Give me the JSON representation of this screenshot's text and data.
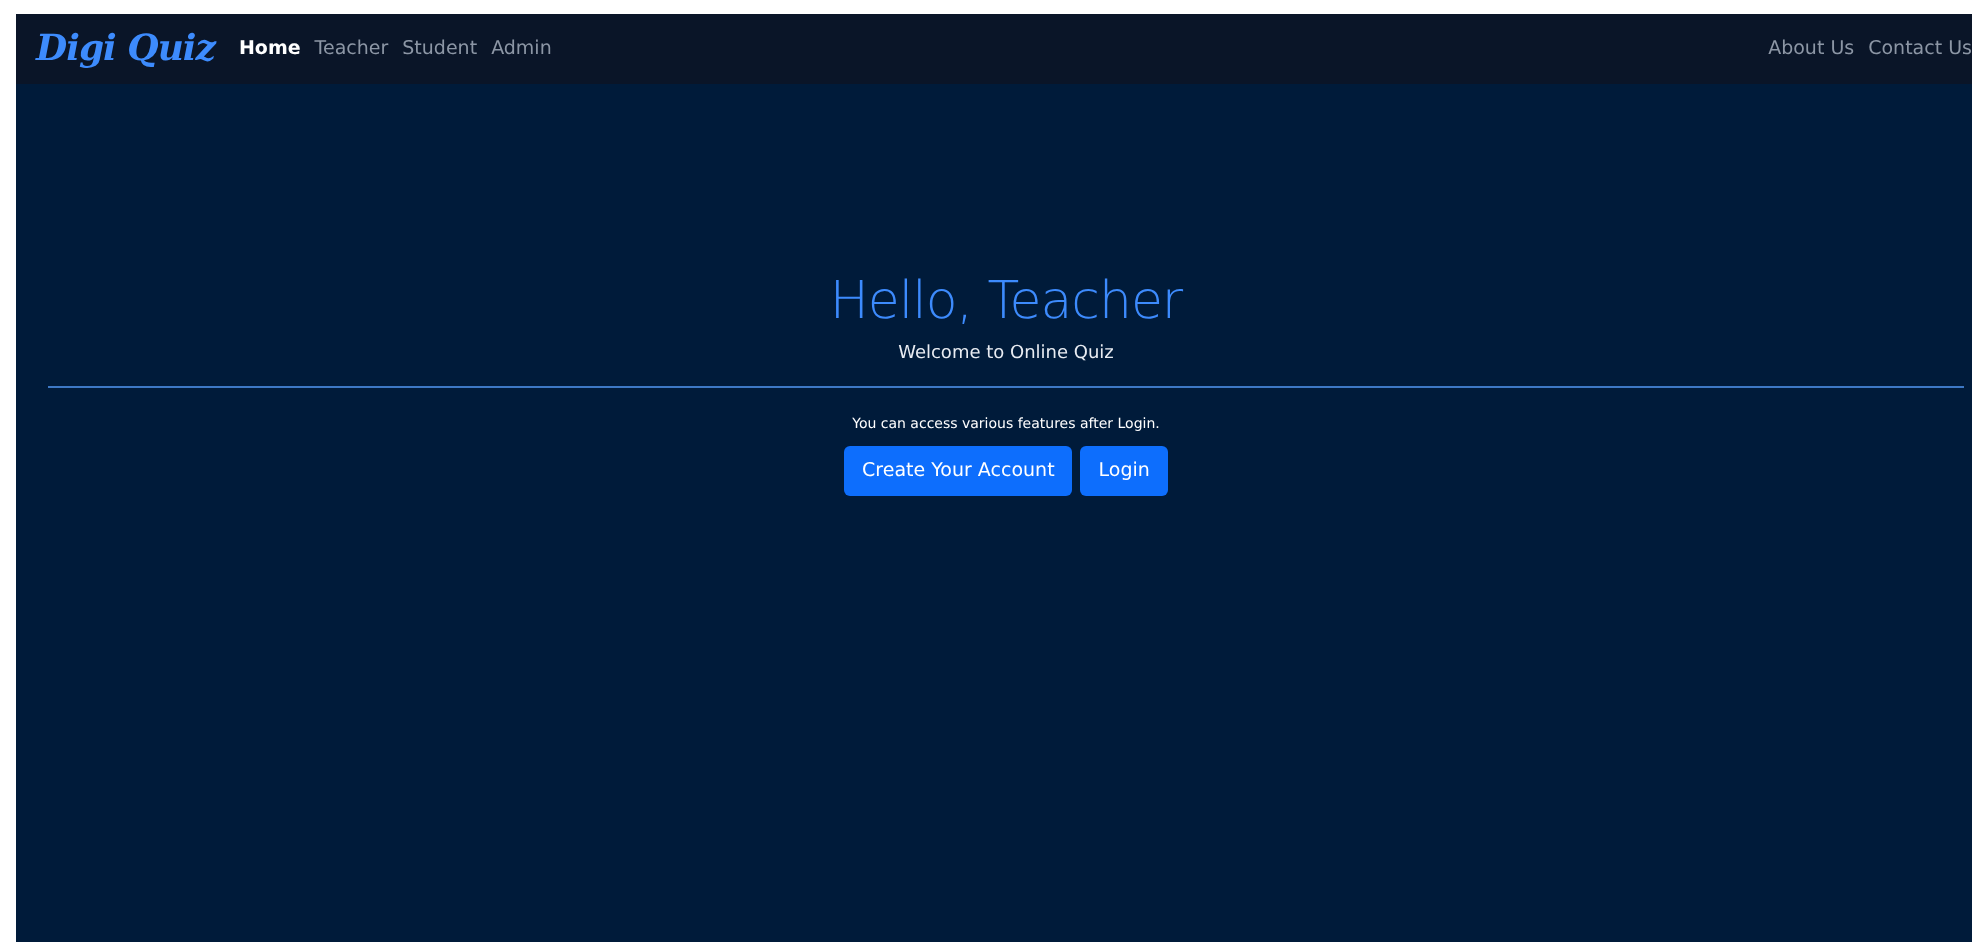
{
  "navbar": {
    "brand": "Digi Quiz",
    "links": [
      {
        "label": "Home",
        "selected": true
      },
      {
        "label": "Teacher",
        "selected": false
      },
      {
        "label": "Student",
        "selected": false
      },
      {
        "label": "Admin",
        "selected": false
      }
    ],
    "right_links": [
      "About Us",
      "Contact Us"
    ]
  },
  "hero": {
    "title": "Hello, Teacher",
    "subtitle": "Welcome to Online Quiz",
    "note": "You can access various features after Login.",
    "buttons": [
      "Create Your Account",
      "Login"
    ]
  }
}
